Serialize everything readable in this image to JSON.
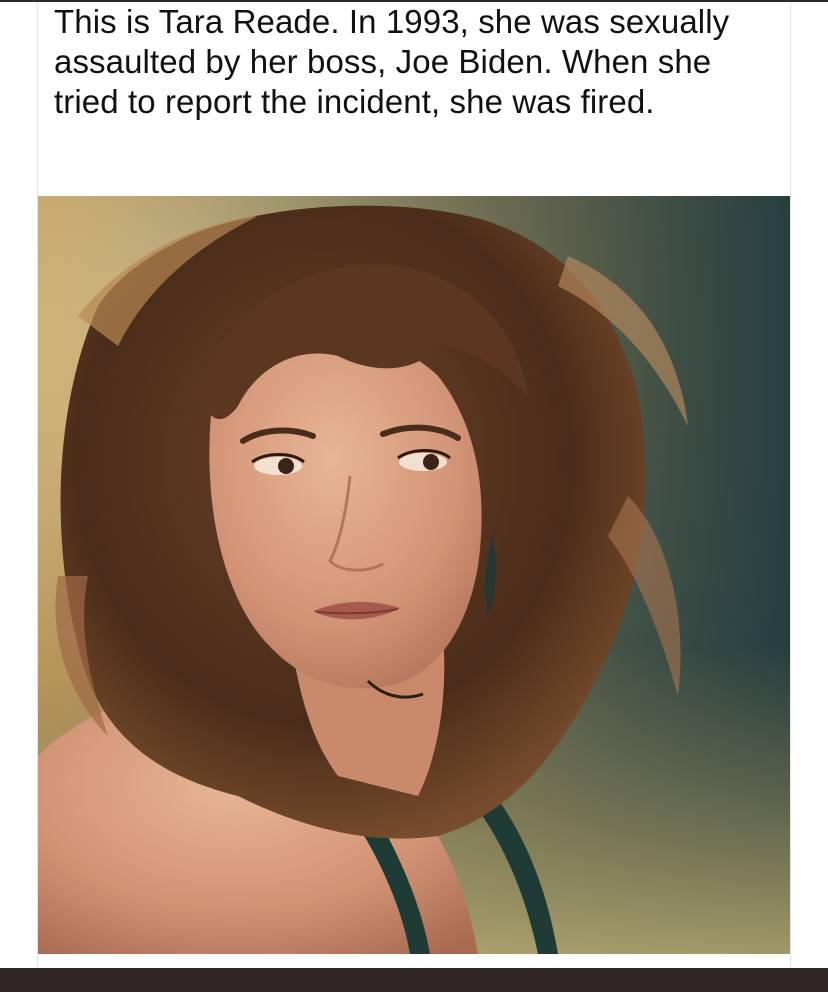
{
  "post": {
    "text": "This is Tara Reade. In 1993, she was sexually assaulted by her boss, Joe Biden. When she tried to report the incident, she was fired."
  },
  "photo": {
    "subject": "portrait photograph of a woman with voluminous brown hair",
    "colors": {
      "background_warm": "#c9a86a",
      "background_cool": "#2e4a4a",
      "hair": "#5a3722",
      "skin": "#d49a7a"
    }
  },
  "colors": {
    "text": "#111111",
    "page_background": "#ffffff",
    "bottom_bar": "#2f2525"
  }
}
